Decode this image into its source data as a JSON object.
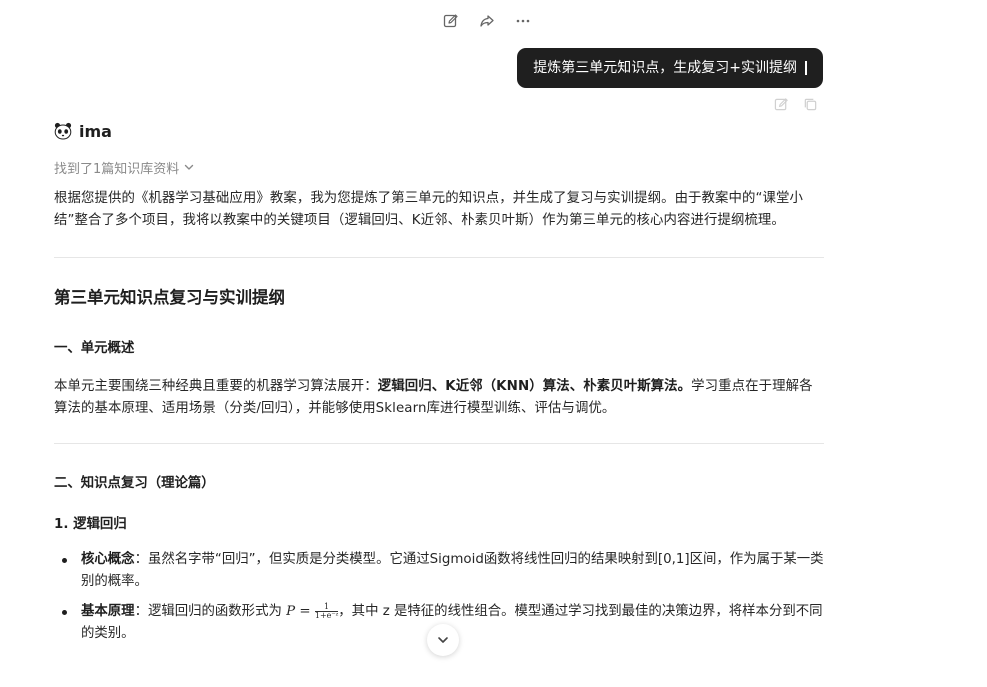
{
  "toolbar": {
    "icons": [
      "edit-icon",
      "share-icon",
      "more-icon"
    ]
  },
  "user_message": {
    "text": "提炼第三单元知识点，生成复习+实训提纲"
  },
  "assistant": {
    "name": "ima",
    "avatar_icon": "panda-icon",
    "kb_found": "找到了1篇知识库资料"
  },
  "answer": {
    "intro": "根据您提供的《机器学习基础应用》教案，我为您提炼了第三单元的知识点，并生成了复习与实训提纲。由于教案中的“课堂小结”整合了多个项目，我将以教案中的关键项目（逻辑回归、K近邻、朴素贝叶斯）作为第三单元的核心内容进行提纲梳理。",
    "title": "第三单元知识点复习与实训提纲",
    "section1": {
      "heading": "一、单元概述",
      "text_before": "本单元主要围绕三种经典且重要的机器学习算法展开：",
      "text_bold": "逻辑回归、K近邻（KNN）算法、朴素贝叶斯算法。",
      "text_after": "学习重点在于理解各算法的基本原理、适用场景（分类/回归），并能够使用Sklearn库进行模型训练、评估与调优。"
    },
    "section2": {
      "heading": "二、知识点复习（理论篇）",
      "sub1": "1. 逻辑回归",
      "points": [
        {
          "label": "核心概念",
          "text": "：虽然名字带“回归”，但实质是分类模型。它通过Sigmoid函数将线性回归的结果映射到[0,1]区间，作为属于某一类别的概率。"
        },
        {
          "label": "基本原理",
          "text_before": "：逻辑回归的函数形式为 ",
          "formula_lhs": "P =",
          "formula_num": "1",
          "formula_den": "1+e⁻ᶻ",
          "text_after": "，其中 z 是特征的线性组合。模型通过学习找到最佳的决策边界，将样本分到不同的类别。"
        }
      ]
    }
  },
  "colors": {
    "bubble_bg": "#1f1f1f",
    "text": "#262626",
    "muted": "#8a8a8a",
    "divider": "#e6e6e6"
  }
}
